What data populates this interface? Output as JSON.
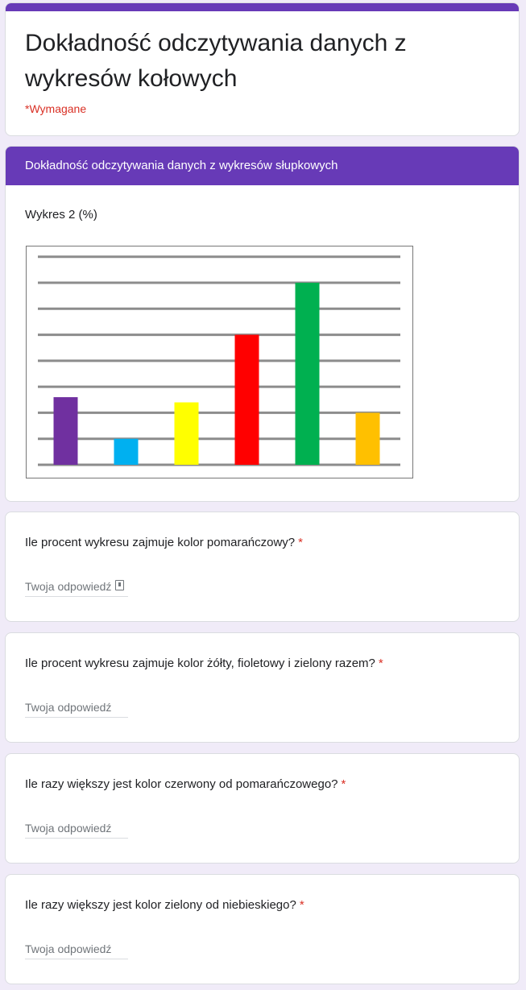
{
  "form": {
    "title": "Dokładność odczytywania danych z wykresów kołowych",
    "required_note": "*Wymagane",
    "accent_color": "#673ab7",
    "required_color": "#d93025"
  },
  "section": {
    "header": "Dokładność odczytywania danych z wykresów słupkowych",
    "caption": "Wykres 2 (%)"
  },
  "chart_data": {
    "type": "bar",
    "title": "",
    "xlabel": "",
    "ylabel": "",
    "ylim": [
      0,
      35
    ],
    "grid": true,
    "gridlines": [
      0,
      5,
      10,
      15,
      20,
      25,
      30,
      35
    ],
    "series": [
      {
        "values": [
          13,
          5,
          12,
          25,
          35,
          10
        ],
        "colors": [
          "#7030a0",
          "#00b0f0",
          "#ffff00",
          "#ff0000",
          "#00b050",
          "#ffc000"
        ]
      }
    ],
    "color_names": [
      "fioletowy",
      "niebieski",
      "żółty",
      "czerwony",
      "zielony",
      "pomarańczowy"
    ]
  },
  "questions": [
    {
      "text": "Ile procent wykresu zajmuje kolor pomarańczowy?",
      "required_mark": "*",
      "placeholder": "Twoja odpowiedź",
      "value": "",
      "show_icon": true
    },
    {
      "text": "Ile procent wykresu zajmuje kolor żółty, fioletowy i zielony razem?",
      "required_mark": "*",
      "placeholder": "Twoja odpowiedź",
      "value": "",
      "show_icon": false
    },
    {
      "text": "Ile razy większy jest kolor czerwony od pomarańczowego?",
      "required_mark": "*",
      "placeholder": "Twoja odpowiedź",
      "value": "",
      "show_icon": false
    },
    {
      "text": "Ile razy większy jest kolor zielony od niebieskiego?",
      "required_mark": "*",
      "placeholder": "Twoja odpowiedź",
      "value": "",
      "show_icon": false
    }
  ]
}
